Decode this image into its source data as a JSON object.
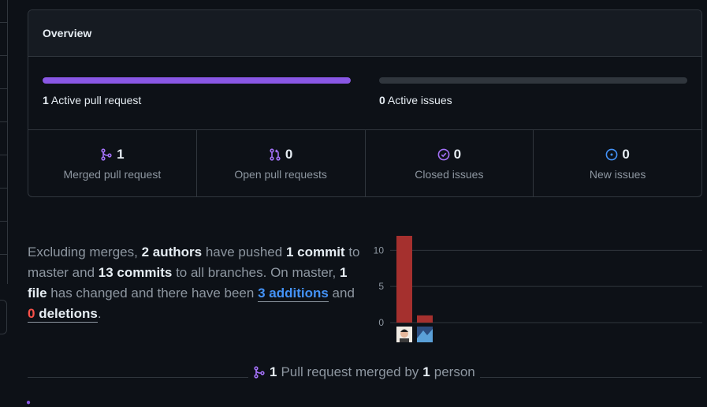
{
  "overview": {
    "title": "Overview",
    "pull_requests": {
      "count": "1",
      "label": "Active pull request",
      "progress": 1.0
    },
    "issues": {
      "count": "0",
      "label": "Active issues",
      "progress": 0.0
    },
    "stats": [
      {
        "icon": "git-merge-icon",
        "value": "1",
        "label": "Merged pull request",
        "color": "#a371f7"
      },
      {
        "icon": "git-pull-request-icon",
        "value": "0",
        "label": "Open pull requests",
        "color": "#a371f7"
      },
      {
        "icon": "issue-closed-icon",
        "value": "0",
        "label": "Closed issues",
        "color": "#a371f7"
      },
      {
        "icon": "issue-opened-icon",
        "value": "0",
        "label": "New issues",
        "color": "#4493f8"
      }
    ]
  },
  "summary": {
    "p1": "Excluding merges,",
    "authors": "2 authors",
    "p2": "have pushed",
    "commit": "1 commit",
    "p3": "to master and",
    "commits": "13 commits",
    "p4": "to all branches. On master,",
    "file": "1 file",
    "p5": "has changed and there have been",
    "additions": "3 additions",
    "p6": "and",
    "deletions_count": "0",
    "deletions_word": "deletions",
    "p7": "."
  },
  "chart_data": {
    "type": "bar",
    "categories": [
      "author-1",
      "author-2"
    ],
    "values": [
      12,
      1
    ],
    "yticks": [
      "0",
      "5",
      "10"
    ],
    "ylim": [
      0,
      12
    ],
    "color": "#a5302e"
  },
  "merged_by": {
    "icon": "git-merge-icon",
    "count": "1",
    "p1": "Pull request merged by",
    "people": "1",
    "p2": "person"
  }
}
